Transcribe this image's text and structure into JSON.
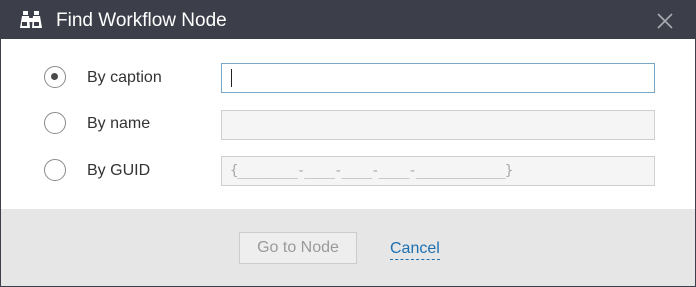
{
  "dialog": {
    "title": "Find Workflow Node",
    "title_icon": "binoculars-icon",
    "close_icon": "close-icon"
  },
  "options": [
    {
      "label": "By caption",
      "selected": true,
      "field_value": "",
      "field_active": true
    },
    {
      "label": "By name",
      "selected": false,
      "field_value": "",
      "field_active": false
    },
    {
      "label": "By GUID",
      "selected": false,
      "field_mask": "{________-____-____-____-____________}",
      "field_active": false
    }
  ],
  "footer": {
    "go_button": "Go to Node",
    "go_button_enabled": false,
    "cancel_link": "Cancel"
  },
  "colors": {
    "titlebar": "#3c3f49",
    "footer": "#e6e6e6",
    "link": "#1e6fb0",
    "active_field_border": "#7aa7c7"
  }
}
